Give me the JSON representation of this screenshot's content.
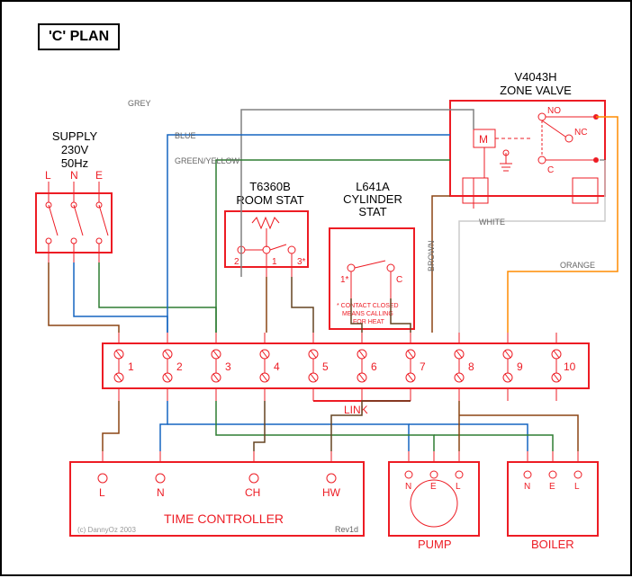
{
  "title": "'C' PLAN",
  "supply": {
    "label": "SUPPLY",
    "voltage": "230V",
    "freq": "50Hz",
    "terms": [
      "L",
      "N",
      "E"
    ]
  },
  "room_stat": {
    "model": "T6360B",
    "name": "ROOM STAT",
    "terms": [
      "2",
      "1",
      "3"
    ]
  },
  "cyl_stat": {
    "model": "L641A",
    "name": "CYLINDER\nSTAT",
    "terms": [
      "1",
      "C"
    ],
    "note": "* CONTACT CLOSED\nMEANS CALLING\nFOR HEAT"
  },
  "zone_valve": {
    "model": "V4043H",
    "name": "ZONE VALVE",
    "M": "M",
    "NO": "NO",
    "NC": "NC",
    "C": "C"
  },
  "junction": {
    "link_label": "LINK",
    "terms": [
      "1",
      "2",
      "3",
      "4",
      "5",
      "6",
      "7",
      "8",
      "9",
      "10"
    ]
  },
  "time_controller": {
    "name": "TIME CONTROLLER",
    "terms": [
      "L",
      "N",
      "CH",
      "HW"
    ]
  },
  "pump": {
    "name": "PUMP",
    "terms": [
      "N",
      "E",
      "L"
    ]
  },
  "boiler": {
    "name": "BOILER",
    "terms": [
      "N",
      "E",
      "L"
    ]
  },
  "wire_colors": {
    "grey": "GREY",
    "blue": "BLUE",
    "greenyellow": "GREEN/YELLOW",
    "brown": "BROWN",
    "orange": "ORANGE",
    "white": "WHITE"
  },
  "credits": {
    "copyright": "(c) DannyOz 2003",
    "rev": "Rev1d"
  }
}
